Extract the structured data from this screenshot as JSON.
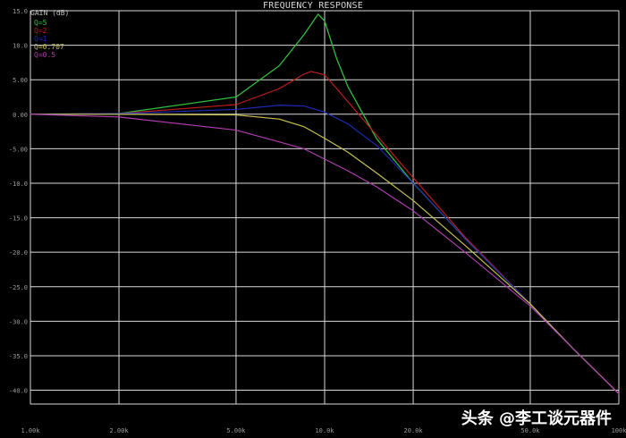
{
  "title": "FREQUENCY RESPONSE",
  "watermark_text": "头条 @李工谈元器件",
  "chart_data": {
    "type": "line",
    "title": "FREQUENCY RESPONSE",
    "ylabel": "GAIN (dB)",
    "xlabel": "",
    "x_scale": "log",
    "xlim": [
      1000,
      100000
    ],
    "ylim": [
      -42,
      15
    ],
    "grid": true,
    "legend_placement": "top-left",
    "y_ticks": [
      15,
      10,
      5,
      0,
      -5,
      -10,
      -15,
      -20,
      -25,
      -30,
      -35,
      -40
    ],
    "y_tick_labels": [
      "15.0",
      "10.0",
      "5.00",
      "0.00",
      "-5.00",
      "-10.0",
      "-15.0",
      "-20.0",
      "-25.0",
      "-30.0",
      "-35.0",
      "-40.0"
    ],
    "x_ticks": [
      1000,
      2000,
      5000,
      10000,
      20000,
      50000,
      100000
    ],
    "x_tick_labels": [
      "1.00k",
      "2.00k",
      "5.00k",
      "10.0k",
      "20.0k",
      "50.0k",
      "100k"
    ],
    "series": [
      {
        "name": "Q=5",
        "color": "#2fbf3f",
        "x": [
          1000,
          2000,
          5000,
          7000,
          8500,
          9500,
          10000,
          11000,
          12000,
          15000,
          20000,
          30000,
          50000,
          70000,
          100000
        ],
        "y": [
          0,
          0.1,
          2.5,
          7.0,
          11.5,
          14.5,
          13.5,
          8.0,
          4.0,
          -3.5,
          -10.0,
          -18.0,
          -27.5,
          -34.0,
          -40.5
        ]
      },
      {
        "name": "Q=2",
        "color": "#c21d1d",
        "x": [
          1000,
          2000,
          5000,
          7000,
          8500,
          9000,
          10000,
          11000,
          12000,
          15000,
          20000,
          30000,
          50000,
          70000,
          100000
        ],
        "y": [
          0,
          0.1,
          1.4,
          3.7,
          5.8,
          6.2,
          5.7,
          3.7,
          1.8,
          -3.0,
          -9.2,
          -17.8,
          -27.5,
          -34.0,
          -40.5
        ]
      },
      {
        "name": "Q=1",
        "color": "#1d2bb8",
        "x": [
          1000,
          2000,
          5000,
          7000,
          8500,
          10000,
          12000,
          15000,
          20000,
          30000,
          50000,
          70000,
          100000
        ],
        "y": [
          0,
          0.1,
          0.7,
          1.3,
          1.2,
          0.3,
          -1.4,
          -4.5,
          -10.0,
          -18.0,
          -27.5,
          -34.0,
          -40.5
        ]
      },
      {
        "name": "Q=0.707",
        "color": "#c9c34f",
        "x": [
          1000,
          2000,
          5000,
          7000,
          8500,
          10000,
          12000,
          15000,
          20000,
          30000,
          50000,
          70000,
          100000
        ],
        "y": [
          0,
          0,
          -0.1,
          -0.7,
          -1.8,
          -3.5,
          -5.5,
          -8.5,
          -12.5,
          -19.0,
          -27.5,
          -34.0,
          -40.5
        ]
      },
      {
        "name": "Q=0.5",
        "color": "#b13cb1",
        "x": [
          1000,
          2000,
          5000,
          7000,
          8500,
          10000,
          12000,
          15000,
          20000,
          30000,
          50000,
          70000,
          100000
        ],
        "y": [
          0,
          -0.4,
          -2.3,
          -4.0,
          -5.0,
          -6.5,
          -8.2,
          -10.5,
          -14.0,
          -20.0,
          -27.8,
          -34.0,
          -40.5
        ]
      }
    ]
  }
}
